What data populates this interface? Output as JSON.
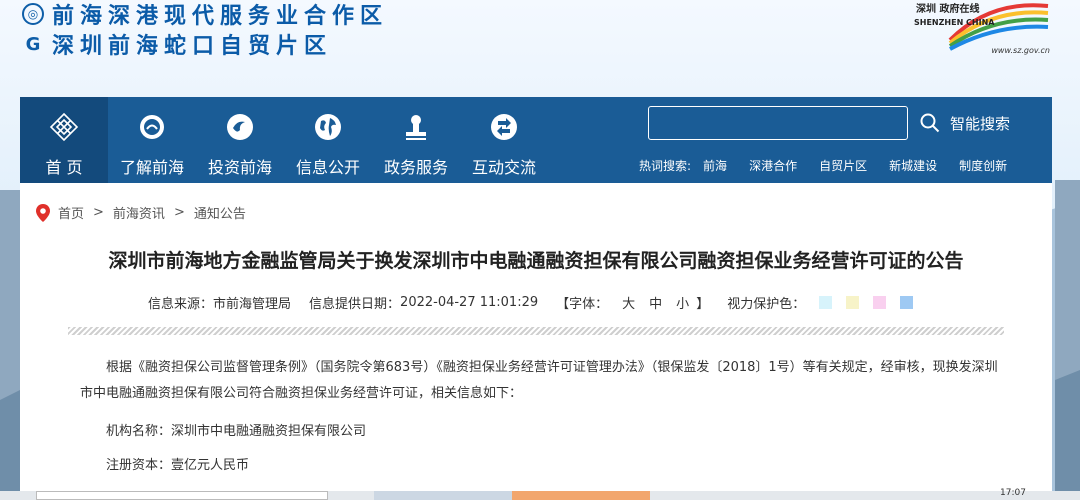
{
  "header": {
    "line1": "前海深港现代服务业合作区",
    "line2": "深圳前海蛇口自贸片区",
    "sz_logo_cn": "深圳 政府在线",
    "sz_logo_en": "SHENZHEN CHINA",
    "sz_logo_url": "www.sz.gov.cn"
  },
  "nav": {
    "items": [
      {
        "label": "首 页",
        "icon": "diamond-grid-icon"
      },
      {
        "label": "了解前海",
        "icon": "emblem-icon"
      },
      {
        "label": "投资前海",
        "icon": "swirl-icon"
      },
      {
        "label": "信息公开",
        "icon": "globe-icon"
      },
      {
        "label": "政务服务",
        "icon": "stamp-icon"
      },
      {
        "label": "互动交流",
        "icon": "exchange-icon"
      }
    ],
    "search_placeholder": "",
    "search_button": "智能搜索",
    "hot_label": "热词搜索:",
    "hot_words": [
      "前海",
      "深港合作",
      "自贸片区",
      "新城建设",
      "制度创新"
    ]
  },
  "breadcrumb": {
    "items": [
      "首页",
      "前海资讯",
      "通知公告"
    ],
    "separator": ">"
  },
  "article": {
    "title": "深圳市前海地方金融监管局关于换发深圳市中电融通融资担保有限公司融资担保业务经营许可证的公告",
    "source_label": "信息来源：",
    "source": "市前海管理局",
    "date_label": "信息提供日期：",
    "date": "2022-04-27 11:01:29",
    "font_label": "【字体：",
    "font_large": "大",
    "font_medium": "中",
    "font_small": "小",
    "font_close": "】",
    "eye_label": "视力保护色：",
    "eye_colors": [
      "#d7f3fb",
      "#f7f3c8",
      "#f9d0ef",
      "#9ec9f3"
    ],
    "paragraph1": "根据《融资担保公司监督管理条例》（国务院令第683号）《融资担保业务经营许可证管理办法》（银保监发〔2018〕1号）等有关规定，经审核，现换发深圳市中电融通融资担保有限公司符合融资担保业务经营许可证，相关信息如下：",
    "paragraph2": "机构名称：深圳市中电融通融资担保有限公司",
    "paragraph3": "注册资本：壹亿元人民币"
  },
  "taskbar": {
    "clock": "17:07"
  },
  "colors": {
    "nav_bg": "#1a5c96",
    "nav_active": "#134a7c",
    "brand_blue": "#0b5ba8",
    "pin_red": "#e0302a"
  }
}
